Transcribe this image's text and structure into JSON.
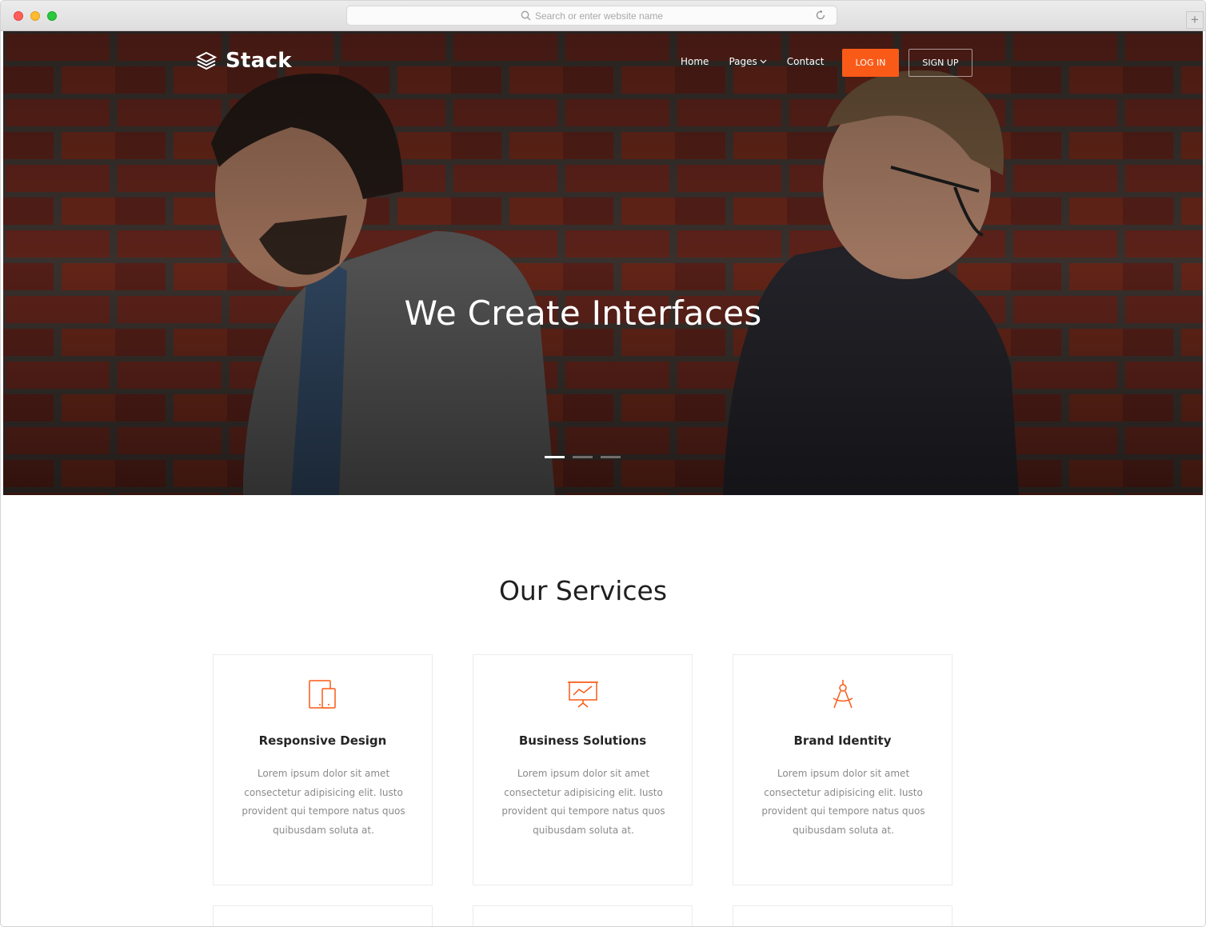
{
  "browser": {
    "address_placeholder": "Search or enter website name",
    "new_tab_label": "+"
  },
  "nav": {
    "brand": "Stack",
    "links": [
      "Home",
      "Pages",
      "Contact"
    ],
    "login_label": "LOG IN",
    "signup_label": "SIGN UP"
  },
  "hero": {
    "title": "We Create Interfaces",
    "slides_count": 3,
    "active_slide": 1
  },
  "services": {
    "title": "Our Services",
    "items": [
      {
        "icon": "devices-icon",
        "title": "Responsive Design",
        "text": "Lorem ipsum dolor sit amet consectetur adipisicing elit. Iusto provident qui tempore natus quos quibusdam soluta at."
      },
      {
        "icon": "presentation-chart-icon",
        "title": "Business Solutions",
        "text": "Lorem ipsum dolor sit amet consectetur adipisicing elit. Iusto provident qui tempore natus quos quibusdam soluta at."
      },
      {
        "icon": "compass-icon",
        "title": "Brand Identity",
        "text": "Lorem ipsum dolor sit amet consectetur adipisicing elit. Iusto provident qui tempore natus quos quibusdam soluta at."
      }
    ]
  },
  "colors": {
    "accent": "#fa5a17",
    "brick": "#7a2d22",
    "mortar": "#4a403b"
  }
}
